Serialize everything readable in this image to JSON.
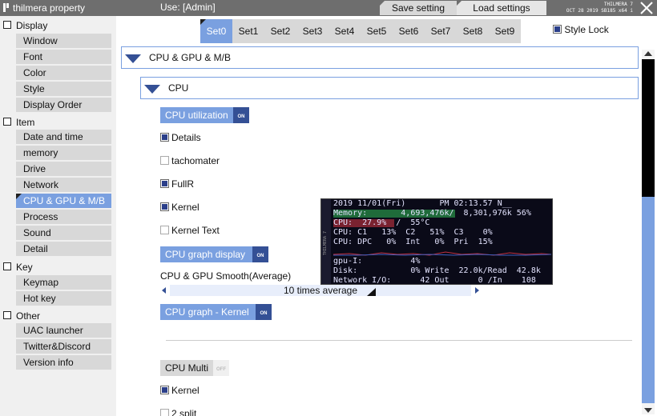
{
  "titlebar": {
    "app_title": "thilmera property",
    "user": "Use: [Admin]",
    "save_label": "Save setting",
    "load_label": "Load settings",
    "info_line1": "THILMERA 7",
    "info_line2": "OCT 28 2019  SB185 x64 i"
  },
  "sidebar": {
    "groups": [
      {
        "label": "Display",
        "items": [
          "Window",
          "Font",
          "Color",
          "Style",
          "Display Order"
        ]
      },
      {
        "label": "Item",
        "items": [
          "Date and time",
          "memory",
          "Drive",
          "Network",
          "CPU & GPU & M/B",
          "Process",
          "Sound",
          "Detail"
        ]
      },
      {
        "label": "Key",
        "items": [
          "Keymap",
          "Hot key"
        ]
      },
      {
        "label": "Other",
        "items": [
          "UAC launcher",
          "Twitter&Discord",
          "Version info"
        ]
      }
    ],
    "selected": "CPU & GPU & M/B"
  },
  "tabs": [
    "Set0",
    "Set1",
    "Set2",
    "Set3",
    "Set4",
    "Set5",
    "Set6",
    "Set7",
    "Set8",
    "Set9"
  ],
  "active_tab": "Set0",
  "style_lock": {
    "label": "Style Lock",
    "checked": true
  },
  "sections": {
    "outer": "CPU & GPU & M/B",
    "inner": "CPU"
  },
  "cpu_utilization": {
    "label": "CPU utilization",
    "badge": "ON",
    "options": [
      {
        "label": "Details",
        "checked": true
      },
      {
        "label": "tachomater",
        "checked": false
      },
      {
        "label": "FullR",
        "checked": true
      },
      {
        "label": "Kernel",
        "checked": true
      },
      {
        "label": "Kernel Text",
        "checked": false
      }
    ]
  },
  "cpu_graph_display": {
    "label": "CPU graph display",
    "badge": "ON"
  },
  "smooth": {
    "label": "CPU & GPU Smooth(Average)",
    "value_text": "10 times average"
  },
  "cpu_graph_kernel": {
    "label": "CPU graph - Kernel",
    "badge": "ON"
  },
  "cpu_multi": {
    "label": "CPU Multi",
    "badge": "OFF",
    "options": [
      {
        "label": "Kernel",
        "checked": true
      },
      {
        "label": "2 split",
        "checked": false
      }
    ]
  },
  "preview": {
    "side_label": "THILMERA 7",
    "lines": [
      "2019 11/01(Fri)       PM 02:13.57 N__",
      "Memory:       4,693,476k/  8,301,976k 56%",
      "CPU:  27.9%  /  55°C",
      "CPU: C1   13%  C2   51%  C3    0%",
      "CPU: DPC   0%  Int   0%  Pri  15%",
      "gpu-I:          4%",
      "Disk:           0% Write  22.0k/Read  42.8k",
      "Network I/O:      42 Out      0 /In    108"
    ],
    "memory_fraction": 0.56,
    "cpu_fraction": 0.279
  },
  "colors": {
    "accent": "#7aa0e0",
    "dark_accent": "#345095",
    "titlebar": "#6e6e6e"
  }
}
